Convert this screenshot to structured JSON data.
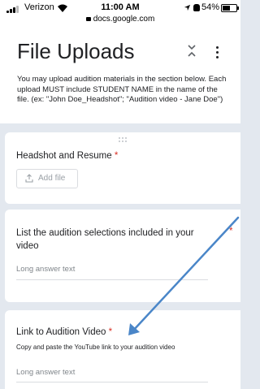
{
  "status_bar": {
    "carrier": "Verizon",
    "time": "11:00 AM",
    "url": "docs.google.com",
    "battery": "54%"
  },
  "form": {
    "title": "File Uploads",
    "description": "You may upload audition materials in the section below. Each upload MUST include STUDENT NAME in the name of the file. (ex: \"John Doe_Headshot\"; \"Audition video - Jane Doe\")"
  },
  "questions": [
    {
      "title": "Headshot and Resume",
      "required": "*",
      "button": "Add file"
    },
    {
      "title": "List the audition selections included in your video",
      "required": "*",
      "placeholder": "Long answer text"
    },
    {
      "title": "Link to Audition Video",
      "required": "*",
      "description": "Copy and paste the YouTube link to your audition video",
      "placeholder": "Long answer text"
    }
  ],
  "annotation": {
    "arrow_color": "#4a86c8"
  }
}
